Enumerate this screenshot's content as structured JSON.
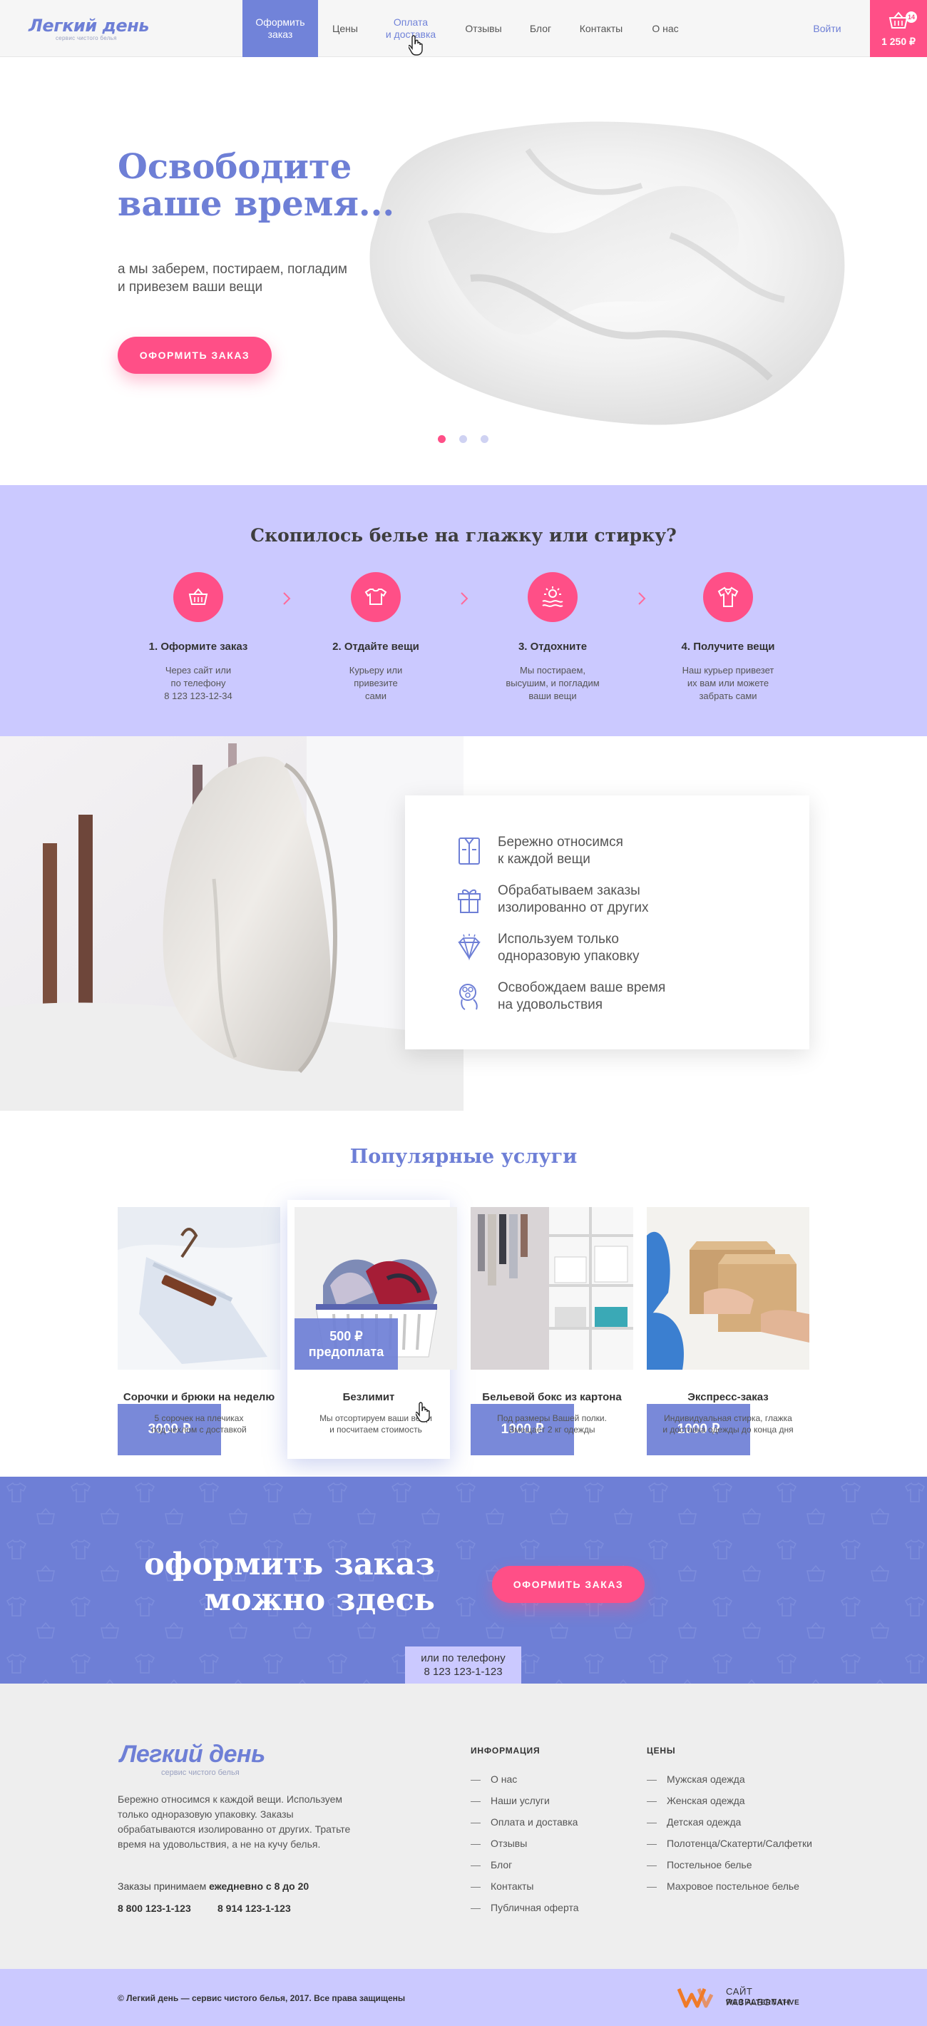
{
  "header": {
    "logo_title": "Легкий день",
    "logo_subtitle": "сервис чистого белья",
    "nav": [
      {
        "label": "Оформить\nзаказ"
      },
      {
        "label": "Цены"
      },
      {
        "label": "Оплата\nи доставка"
      },
      {
        "label": "Отзывы"
      },
      {
        "label": "Блог"
      },
      {
        "label": "Контакты"
      },
      {
        "label": "О нас"
      }
    ],
    "login": "Войти",
    "cart_count": "14",
    "cart_total": "1 250 ₽"
  },
  "hero": {
    "title": "Освободите\nваше время...",
    "subtitle": "а мы заберем, постираем, погладим\nи привезем ваши вещи",
    "button": "ОФОРМИТЬ ЗАКАЗ"
  },
  "steps": {
    "title": "Скопилось белье на глажку или стирку?",
    "items": [
      {
        "icon": "basket-icon",
        "title": "1. Оформите заказ",
        "text": "Через сайт или\nпо телефону\n8 123 123-12-34"
      },
      {
        "icon": "clothes-icon",
        "title": "2. Отдайте вещи",
        "text": "Курьеру или\nпривезите\nсами"
      },
      {
        "icon": "relax-icon",
        "title": "3. Отдохните",
        "text": "Мы постираем,\nвысушим, и погладим\nваши вещи"
      },
      {
        "icon": "shirt-icon",
        "title": "4. Получите вещи",
        "text": "Наш курьер привезет\nих вам или можете\nзабрать сами"
      }
    ]
  },
  "features": [
    {
      "icon": "shirt-outline-icon",
      "text": "Бережно относимся\nк каждой вещи"
    },
    {
      "icon": "gift-icon",
      "text": "Обрабатываем заказы\nизолированно от других"
    },
    {
      "icon": "diamond-icon",
      "text": "Используем только\nодноразовую упаковку"
    },
    {
      "icon": "person-icon",
      "text": "Освобождаем ваше время\nна удовольствия"
    }
  ],
  "services": {
    "title": "Популярные услуги",
    "items": [
      {
        "price": "3000 ₽",
        "name": "Сорочки и брюки на неделю",
        "desc": "5 сорочек на плечиках\nпод чехлом с доставкой"
      },
      {
        "price": "500 ₽\nпредоплата",
        "name": "Безлимит",
        "desc": "Мы отсортируем ваши вещи\nи посчитаем стоимость"
      },
      {
        "price": "1000 ₽",
        "name": "Бельевой бокс из картона",
        "desc": "Под размеры Вашей полки.\nВмещает 2 кг одежды"
      },
      {
        "price": "1000 ₽",
        "name": "Экспресс-заказ",
        "desc": "Индивидуальная стирка, глажка\nи доставка одежды до конца дня"
      }
    ]
  },
  "cta": {
    "title": "оформить заказ\nможно здесь",
    "button": "ОФОРМИТЬ ЗАКАЗ",
    "phone_label": "или по телефону",
    "phone": "8 123 123-1-123"
  },
  "footer": {
    "logo_title": "Легкий день",
    "logo_subtitle": "сервис чистого белья",
    "about": "Бережно относимся к каждой вещи. Используем только одноразовую упаковку.  Заказы обрабатываются изолированно от других. Тратьте время на удовольствия, а не на кучу белья.",
    "hours_prefix": "Заказы  принимаем ",
    "hours": "ежедневно с 8 до 20",
    "phone1": "8 800 123-1-123",
    "phone2": "8 914  123-1-123",
    "info_title": "ИНФОРМАЦИЯ",
    "info_links": [
      "О нас",
      "Наши услуги",
      "Оплата и доставка",
      "Отзывы",
      "Блог",
      "Контакты",
      "Публичная оферта"
    ],
    "prices_title": "ЦЕНЫ",
    "price_links": [
      "Мужская одежда",
      "Женская одежда",
      "Детская одежда",
      "Полотенца/Скатерти/Салфетки",
      "Постельное белье",
      "Махровое постельное белье"
    ],
    "copyright": "© Легкий день — сервис чистого белья, 2017. Все права защищены",
    "dev_line1": "САЙТ РАЗРАБОТАН",
    "dev_line2": "WEB ALTERNATIVE"
  },
  "colors": {
    "accent": "#6e7fd6",
    "pink": "#ff4f87",
    "lavender": "#cbc9ff"
  }
}
